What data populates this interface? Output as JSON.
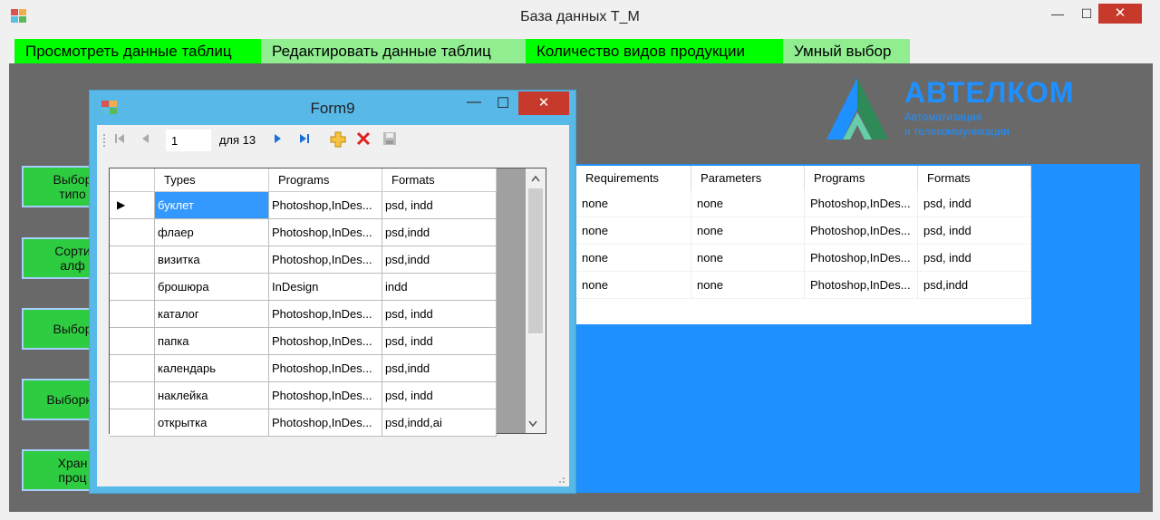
{
  "main_window": {
    "title": "База данных T_M",
    "minimize_glyph": "—",
    "maximize_glyph": "☐",
    "close_glyph": "✕"
  },
  "menu": [
    {
      "label": "Просмотреть данные таблиц",
      "color": "#00ff00"
    },
    {
      "label": "Редактировать данные таблиц",
      "color": "#90ee90"
    },
    {
      "label": "Количество видов продукции",
      "color": "#00ff00"
    },
    {
      "label": "Умный выбор",
      "color": "#90ee90"
    }
  ],
  "logo": {
    "name": "АВТЕЛКОМ",
    "sub1": "Автоматизация",
    "sub2": "и телекоммуникации",
    "color": "#1e90ff"
  },
  "side_buttons": [
    "Выбор\nтипо",
    "Сорти\nалф",
    "Выбор",
    "Выборка",
    "Хран\nпроц"
  ],
  "background_grid": {
    "columns": [
      "Requirements",
      "Parameters",
      "Programs",
      "Formats"
    ],
    "rows": [
      [
        "none",
        "none",
        "Photoshop,InDes...",
        "psd, indd"
      ],
      [
        "none",
        "none",
        "Photoshop,InDes...",
        "psd, indd"
      ],
      [
        "none",
        "none",
        "Photoshop,InDes...",
        "psd, indd"
      ],
      [
        "none",
        "none",
        "Photoshop,InDes...",
        "psd,indd"
      ]
    ]
  },
  "form9": {
    "title": "Form9",
    "navigator": {
      "position": "1",
      "count_label": "для 13"
    },
    "grid": {
      "columns": [
        "Types",
        "Programs",
        "Formats"
      ],
      "rows": [
        [
          "буклет",
          "Photoshop,InDes...",
          "psd, indd"
        ],
        [
          "флаер",
          "Photoshop,InDes...",
          "psd,indd"
        ],
        [
          "визитка",
          "Photoshop,InDes...",
          "psd,indd"
        ],
        [
          "брошюра",
          "InDesign",
          "indd"
        ],
        [
          "каталог",
          "Photoshop,InDes...",
          "psd, indd"
        ],
        [
          "папка",
          "Photoshop,InDes...",
          "psd, indd"
        ],
        [
          "календарь",
          "Photoshop,InDes...",
          "psd,indd"
        ],
        [
          "наклейка",
          "Photoshop,InDes...",
          "psd, indd"
        ],
        [
          "открытка",
          "Photoshop,InDes...",
          "psd,indd,ai"
        ]
      ],
      "current_row_marker": "▶",
      "selected_color": "#3399ff"
    }
  }
}
